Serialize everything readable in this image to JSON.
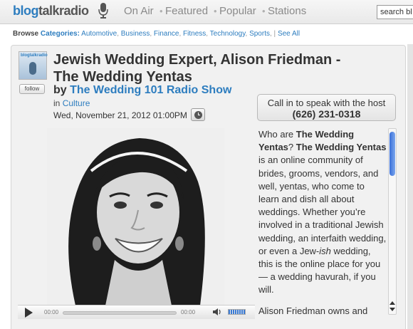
{
  "header": {
    "logo_part1": "blog",
    "logo_part2": "talkradio",
    "nav": [
      "On Air",
      "Featured",
      "Popular",
      "Stations"
    ],
    "search_value": "search bl"
  },
  "browse": {
    "label": "Browse",
    "categories_label": "Categories:",
    "items": [
      "Automotive",
      "Business",
      "Finance",
      "Fitness",
      "Technology",
      "Sports"
    ],
    "see_all": "See All"
  },
  "episode": {
    "thumb_logo": "blogtalkradio",
    "follow_label": "follow",
    "title": "Jewish Wedding Expert, Alison Friedman - The Wedding Yentas",
    "by": "by",
    "show_name": "The Wedding 101 Radio Show",
    "in": "in",
    "category": "Culture",
    "datetime": "Wed, November 21, 2012 01:00PM"
  },
  "callin": {
    "label": "Call in to speak with the host",
    "phone": "(626) 231-0318"
  },
  "player": {
    "time_start": "00:00",
    "time_end": "00:00",
    "volume_level": 0.7
  },
  "description": {
    "p1_a": "Who are ",
    "p1_b": "The Wedding Yentas",
    "p1_c": "? ",
    "p1_d": "The Wedding Yentas",
    "p1_e": " is an online community of brides, grooms, vendors, and well, yentas, who come to learn and dish all about weddings. Whether you’re involved in a traditional Jewish wedding, an interfaith wedding, or even a Jew-",
    "p1_f": "ish",
    "p1_g": " wedding, this is the online place for you — a wedding havurah, if you will.",
    "p2": "Alison Friedman owns and"
  },
  "colors": {
    "accent": "#2d7dbf",
    "scroll_thumb": "#3a6fd8"
  }
}
